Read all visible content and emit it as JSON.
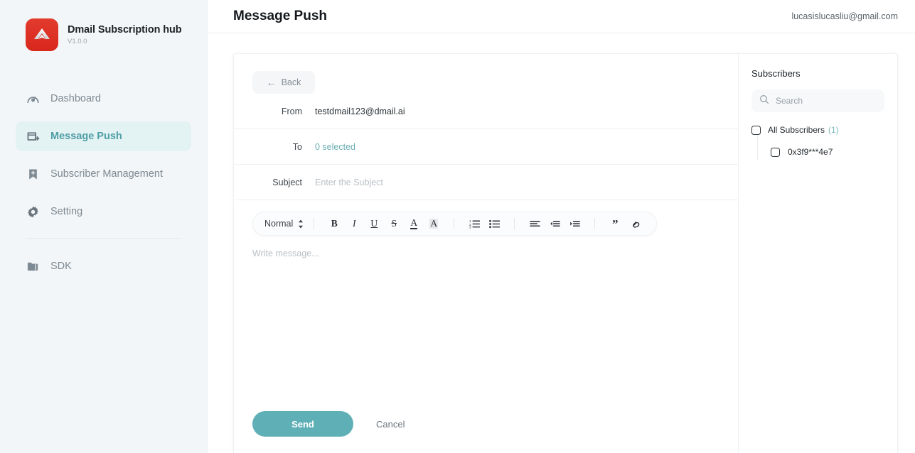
{
  "brand": {
    "title": "Dmail Subscription hub",
    "version": "V1.0.0",
    "logo_icon": "dmail-arrow-logo",
    "logo_color": "#d8271c"
  },
  "sidebar": {
    "items": [
      {
        "label": "Dashboard",
        "icon": "dashboard-gauge-icon",
        "active": false
      },
      {
        "label": "Message Push",
        "icon": "message-push-icon",
        "active": true
      },
      {
        "label": "Subscriber Management",
        "icon": "bookmark-add-icon",
        "active": false
      },
      {
        "label": "Setting",
        "icon": "gear-icon",
        "active": false
      }
    ],
    "footer_items": [
      {
        "label": "SDK",
        "icon": "folder-icon",
        "active": false
      }
    ],
    "active_color": "#4f9ea6",
    "active_bg": "#e3f2f3"
  },
  "header": {
    "title": "Message Push",
    "user_email": "lucasislucasliu@gmail.com"
  },
  "compose": {
    "back_label": "Back",
    "back_icon": "arrow-left-icon",
    "fields": [
      {
        "label": "From",
        "value": "testdmail123@dmail.ai",
        "style": "plain"
      },
      {
        "label": "To",
        "value": "0 selected",
        "style": "teal"
      },
      {
        "label": "Subject",
        "value": "",
        "placeholder": "Enter the Subject",
        "style": "placeholder"
      }
    ],
    "body_placeholder": "Write message...",
    "send_label": "Send",
    "cancel_label": "Cancel",
    "send_color": "#5fb0b6"
  },
  "toolbar": {
    "format_select": "Normal",
    "select_icon": "chevron-updown-icon",
    "groups": [
      [
        {
          "name": "bold-icon",
          "glyph": "B",
          "bold": true,
          "italic": false
        },
        {
          "name": "italic-icon",
          "glyph": "I",
          "bold": false,
          "italic": true
        },
        {
          "name": "underline-icon",
          "glyph": "U",
          "bold": false,
          "italic": false
        },
        {
          "name": "strikethrough-icon",
          "glyph": "S",
          "bold": false,
          "italic": false
        },
        {
          "name": "text-color-icon",
          "glyph": "A",
          "bold": false,
          "italic": false
        },
        {
          "name": "highlight-color-icon",
          "glyph": "A",
          "bold": false,
          "italic": false
        }
      ],
      [
        {
          "name": "ordered-list-icon",
          "glyph": "",
          "bold": false,
          "italic": false
        },
        {
          "name": "bullet-list-icon",
          "glyph": "",
          "bold": false,
          "italic": false
        }
      ],
      [
        {
          "name": "align-left-icon",
          "glyph": "",
          "bold": false,
          "italic": false
        },
        {
          "name": "indent-decrease-icon",
          "glyph": "",
          "bold": false,
          "italic": false
        },
        {
          "name": "indent-increase-icon",
          "glyph": "",
          "bold": false,
          "italic": false
        }
      ],
      [
        {
          "name": "blockquote-icon",
          "glyph": "”",
          "bold": true,
          "italic": false
        },
        {
          "name": "link-icon",
          "glyph": "",
          "bold": false,
          "italic": false
        }
      ]
    ]
  },
  "subscribers": {
    "title": "Subscribers",
    "search_placeholder": "Search",
    "search_value": "",
    "search_icon": "search-icon",
    "all_label": "All Subscribers",
    "all_count": "(1)",
    "all_checked": false,
    "count_color": "#7fb9be",
    "list": [
      {
        "label": "0x3f9***4e7",
        "checked": false
      }
    ]
  }
}
